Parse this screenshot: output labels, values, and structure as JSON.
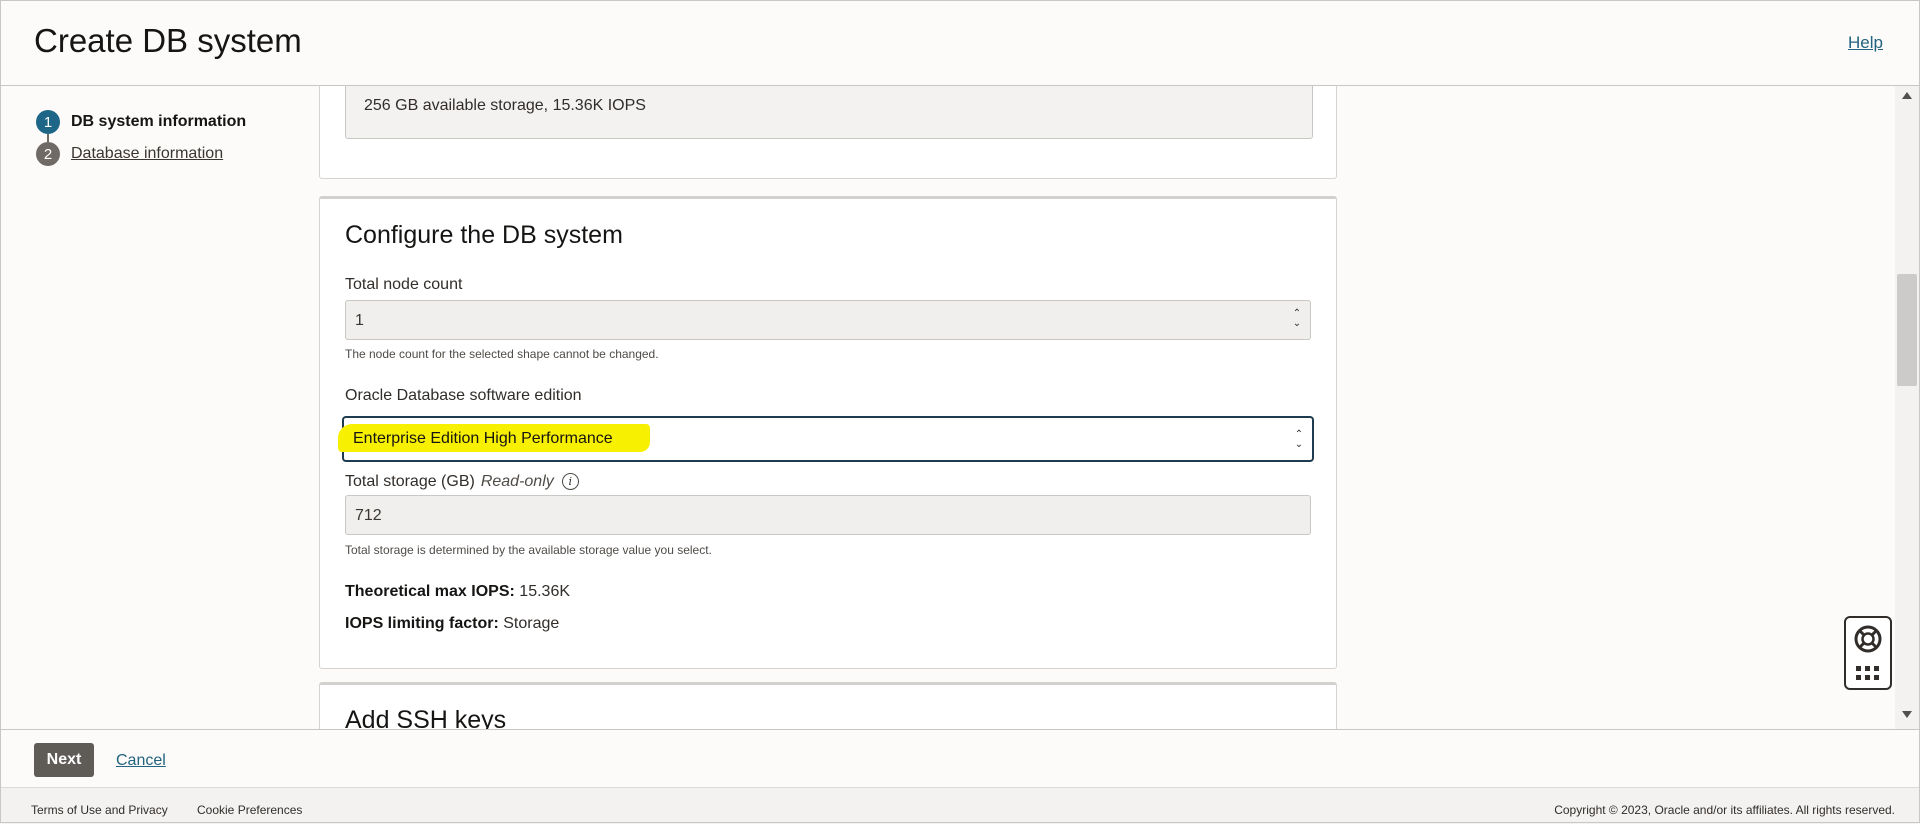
{
  "header": {
    "title": "Create DB system",
    "help_label": "Help"
  },
  "steps": [
    {
      "number": "1",
      "label": "DB system information",
      "state": "current"
    },
    {
      "number": "2",
      "label": "Database information",
      "state": "link"
    }
  ],
  "storage_card": {
    "text": "256 GB available storage, 15.36K IOPS"
  },
  "config": {
    "title": "Configure the DB system",
    "node_count_label": "Total node count",
    "node_count_value": "1",
    "node_count_help": "The node count for the selected shape cannot be changed.",
    "edition_label": "Oracle Database software edition",
    "edition_value": "Enterprise Edition High Performance",
    "storage_label": "Total storage (GB)",
    "storage_readonly": "Read-only",
    "storage_value": "712",
    "storage_help": "Total storage is determined by the available storage value you select.",
    "iops_label": "Theoretical max IOPS:",
    "iops_value": "15.36K",
    "limiting_label": "IOPS limiting factor:",
    "limiting_value": "Storage"
  },
  "ssh": {
    "title": "Add SSH keys"
  },
  "actions": {
    "next_label": "Next",
    "cancel_label": "Cancel"
  },
  "footer": {
    "terms": "Terms of Use and Privacy",
    "cookies": "Cookie Preferences",
    "copyright": "Copyright © 2023, Oracle and/or its affiliates. All rights reserved."
  },
  "colors": {
    "accent": "#1d6687",
    "highlight": "#f7f000",
    "link": "#22637f"
  },
  "icons": [
    "info-icon",
    "spinner-icon",
    "lifebuoy-icon",
    "grid-icon"
  ]
}
